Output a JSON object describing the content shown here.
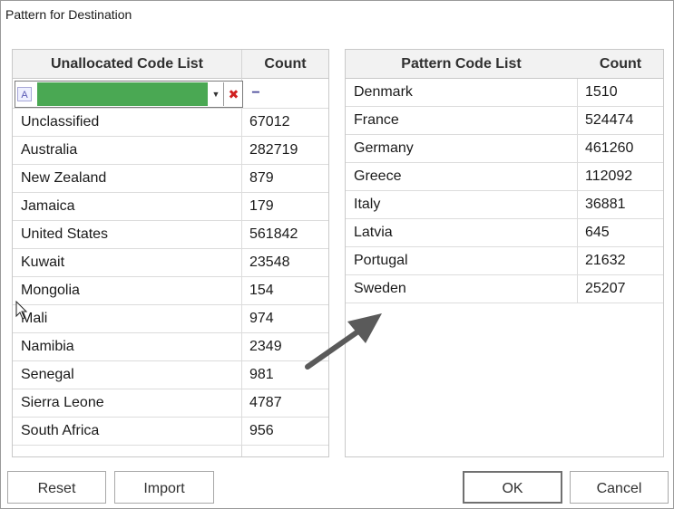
{
  "window": {
    "title": "Pattern for Destination"
  },
  "left_grid": {
    "headers": {
      "name": "Unallocated Code List",
      "count": "Count"
    },
    "filter": {
      "minus_label": "−"
    },
    "rows": [
      {
        "name": "Unclassified",
        "count": "67012"
      },
      {
        "name": "Australia",
        "count": "282719"
      },
      {
        "name": "New Zealand",
        "count": "879"
      },
      {
        "name": "Jamaica",
        "count": "179"
      },
      {
        "name": "United States",
        "count": "561842"
      },
      {
        "name": "Kuwait",
        "count": "23548"
      },
      {
        "name": "Mongolia",
        "count": "154"
      },
      {
        "name": "Mali",
        "count": "974"
      },
      {
        "name": "Namibia",
        "count": "2349"
      },
      {
        "name": "Senegal",
        "count": "981"
      },
      {
        "name": "Sierra Leone",
        "count": "4787"
      },
      {
        "name": "South Africa",
        "count": "956"
      }
    ]
  },
  "right_grid": {
    "headers": {
      "name": "Pattern Code List",
      "count": "Count"
    },
    "rows": [
      {
        "name": "Denmark",
        "count": "1510"
      },
      {
        "name": "France",
        "count": "524474"
      },
      {
        "name": "Germany",
        "count": "461260"
      },
      {
        "name": "Greece",
        "count": "112092"
      },
      {
        "name": "Italy",
        "count": "36881"
      },
      {
        "name": "Latvia",
        "count": "645"
      },
      {
        "name": "Portugal",
        "count": "21632"
      },
      {
        "name": "Sweden",
        "count": "25207"
      }
    ]
  },
  "buttons": {
    "reset": "Reset",
    "import": "Import",
    "ok": "OK",
    "cancel": "Cancel"
  },
  "colors": {
    "filter_fill": "#4aa853",
    "arrow": "#5a5a5a",
    "header_bg": "#f2f2f2"
  }
}
